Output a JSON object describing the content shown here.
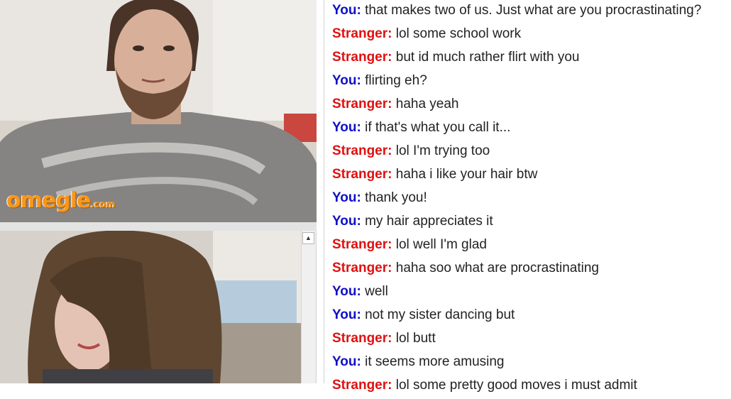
{
  "brand": {
    "logo_text": "omegle",
    "logo_tld": ".com",
    "logo_color": "#f7971d"
  },
  "speaker_colors": {
    "you": "#1010c8",
    "stranger": "#e01010"
  },
  "scrollbar": {
    "up_icon": "▲"
  },
  "messages": [
    {
      "speaker": "you",
      "who": "You:",
      "text": "that makes two of us. Just what are you procrastinating?"
    },
    {
      "speaker": "stranger",
      "who": "Stranger:",
      "text": "lol some school work"
    },
    {
      "speaker": "stranger",
      "who": "Stranger:",
      "text": "but id much rather flirt with you"
    },
    {
      "speaker": "you",
      "who": "You:",
      "text": "flirting eh?"
    },
    {
      "speaker": "stranger",
      "who": "Stranger:",
      "text": "haha yeah"
    },
    {
      "speaker": "you",
      "who": "You:",
      "text": "if that's what you call it..."
    },
    {
      "speaker": "stranger",
      "who": "Stranger:",
      "text": "lol I'm trying too"
    },
    {
      "speaker": "stranger",
      "who": "Stranger:",
      "text": "haha i like your hair btw"
    },
    {
      "speaker": "you",
      "who": "You:",
      "text": "thank you!"
    },
    {
      "speaker": "you",
      "who": "You:",
      "text": "my hair appreciates it"
    },
    {
      "speaker": "stranger",
      "who": "Stranger:",
      "text": "lol well I'm glad"
    },
    {
      "speaker": "stranger",
      "who": "Stranger:",
      "text": "haha soo what are procrastinating"
    },
    {
      "speaker": "you",
      "who": "You:",
      "text": "well"
    },
    {
      "speaker": "you",
      "who": "You:",
      "text": "not my sister dancing but"
    },
    {
      "speaker": "stranger",
      "who": "Stranger:",
      "text": "lol butt"
    },
    {
      "speaker": "you",
      "who": "You:",
      "text": "it seems more amusing"
    },
    {
      "speaker": "stranger",
      "who": "Stranger:",
      "text": "lol some pretty good moves i must admit"
    }
  ]
}
